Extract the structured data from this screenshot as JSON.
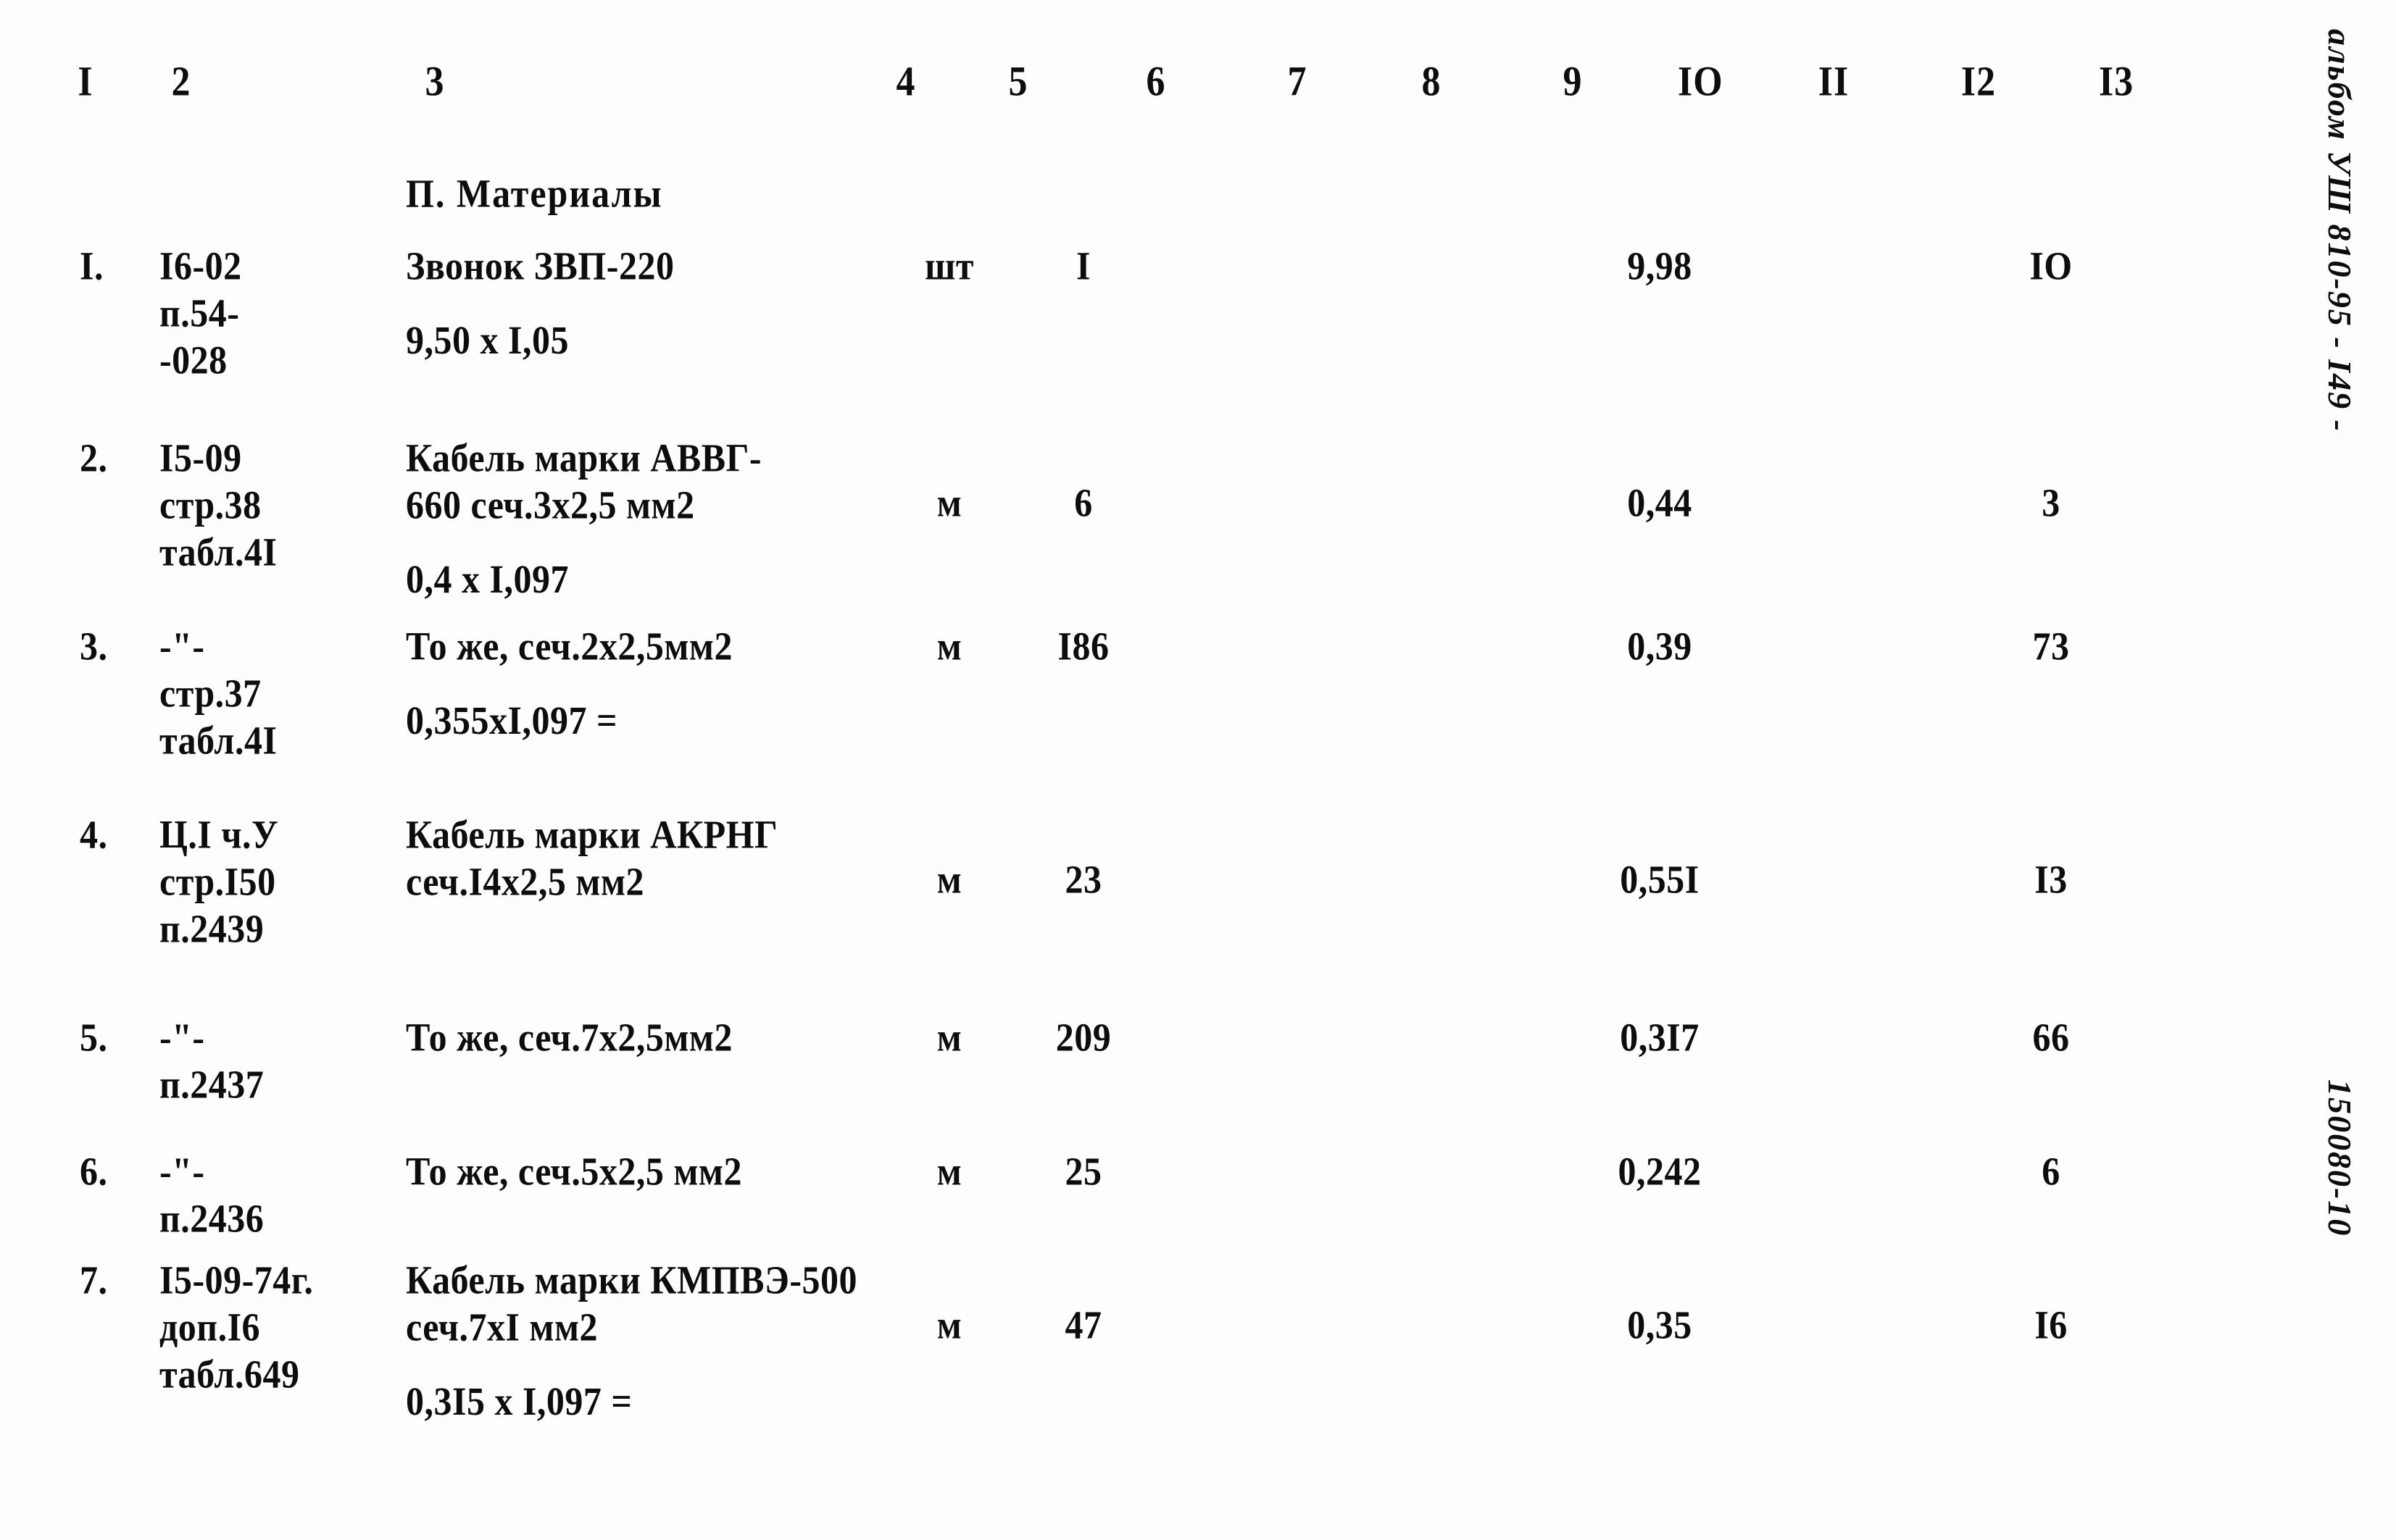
{
  "document": {
    "section_heading": "П. Материалы",
    "column_headers": [
      "I",
      "2",
      "3",
      "4",
      "5",
      "6",
      "7",
      "8",
      "9",
      "IO",
      "II",
      "I2",
      "I3"
    ],
    "dash_rule": "- - - - - - - - - - - - - - - - - - - - - - - - - - - - - - - - - - - - - - - - - - - - - - - - - - - - - - - - -",
    "margin_album": "альбом УШ 810-95   -  I49  -",
    "margin_code": "150080-10"
  },
  "rows": [
    {
      "no": "I.",
      "ref_lines": [
        "I6-02",
        "п.54-",
        "-028"
      ],
      "desc_lines": [
        "Звонок ЗВП-220"
      ],
      "calc": "9,50 х I,05",
      "unit": "шт",
      "qty": "I",
      "price": "9,98",
      "total": "IO"
    },
    {
      "no": "2.",
      "ref_lines": [
        "I5-09",
        "стр.38",
        "табл.4I"
      ],
      "desc_lines": [
        "Кабель марки АВВГ-",
        "660 сеч.3х2,5 мм2"
      ],
      "calc": "0,4 х I,097",
      "unit": "м",
      "qty": "6",
      "price": "0,44",
      "total": "3"
    },
    {
      "no": "3.",
      "ref_lines": [
        "-\"-",
        "стр.37",
        "табл.4I"
      ],
      "desc_lines": [
        "То же, сеч.2х2,5мм2"
      ],
      "calc": "0,355хI,097 =",
      "unit": "м",
      "qty": "I86",
      "price": "0,39",
      "total": "73"
    },
    {
      "no": "4.",
      "ref_lines": [
        "Ц.I ч.У",
        "стр.I50",
        "п.2439"
      ],
      "desc_lines": [
        "Кабель марки АКРНГ",
        "сеч.I4х2,5 мм2"
      ],
      "calc": "",
      "unit": "м",
      "qty": "23",
      "price": "0,55I",
      "total": "I3"
    },
    {
      "no": "5.",
      "ref_lines": [
        "-\"-",
        "п.2437"
      ],
      "desc_lines": [
        "То же, сеч.7х2,5мм2"
      ],
      "calc": "",
      "unit": "м",
      "qty": "209",
      "price": "0,3I7",
      "total": "66"
    },
    {
      "no": "6.",
      "ref_lines": [
        "-\"-",
        "п.2436"
      ],
      "desc_lines": [
        "То же, сеч.5х2,5 мм2"
      ],
      "calc": "",
      "unit": "м",
      "qty": "25",
      "price": "0,242",
      "total": "6"
    },
    {
      "no": "7.",
      "ref_lines": [
        "I5-09-74г.",
        "доп.I6",
        "табл.649"
      ],
      "desc_lines": [
        "Кабель марки КМПВЭ-500",
        "сеч.7хI мм2"
      ],
      "calc": "0,3I5 х I,097 =",
      "unit": "м",
      "qty": "47",
      "price": "0,35",
      "total": "I6"
    }
  ]
}
